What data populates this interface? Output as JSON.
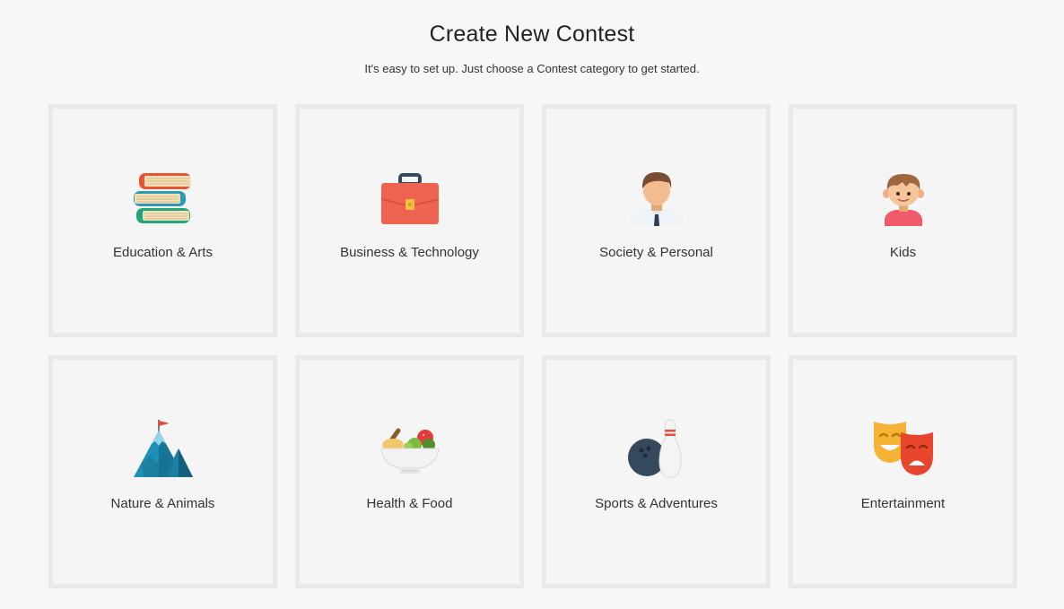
{
  "header": {
    "title": "Create New Contest",
    "subtitle": "It's easy to set up. Just choose a Contest category to get started."
  },
  "categories": [
    {
      "label": "Education & Arts",
      "icon": "books-icon"
    },
    {
      "label": "Business & Technology",
      "icon": "briefcase-icon"
    },
    {
      "label": "Society & Personal",
      "icon": "businessman-icon"
    },
    {
      "label": "Kids",
      "icon": "kid-icon"
    },
    {
      "label": "Nature & Animals",
      "icon": "mountain-icon"
    },
    {
      "label": "Health & Food",
      "icon": "food-bowl-icon"
    },
    {
      "label": "Sports & Adventures",
      "icon": "bowling-icon"
    },
    {
      "label": "Entertainment",
      "icon": "theater-masks-icon"
    }
  ],
  "colors": {
    "background": "#f7f7f7",
    "card_border": "#e8e9ea",
    "card_fill": "#f5f5f5"
  }
}
